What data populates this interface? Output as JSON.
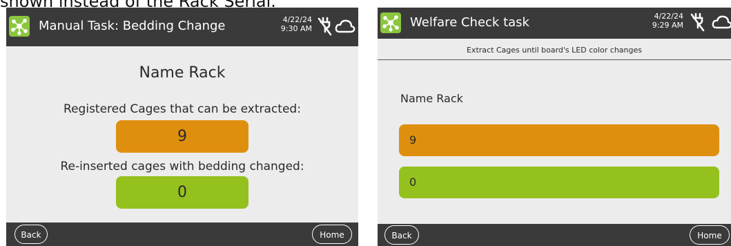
{
  "caption": "shown instead of the Rack Serial.",
  "left": {
    "title": "Manual Task: Bedding Change",
    "date": "4/22/24",
    "time": "9:30 AM",
    "rack_name": "Name Rack",
    "registered_label": "Registered Cages that can be extracted:",
    "registered_value": "9",
    "reinserted_label": "Re-inserted cages with bedding changed:",
    "reinserted_value": "0",
    "back_label": "Back",
    "home_label": "Home"
  },
  "right": {
    "title": "Welfare Check task",
    "date": "4/22/24",
    "time": "9:29 AM",
    "instruction": "Extract Cages until board's LED color changes",
    "rack_name": "Name Rack",
    "orange_value": "9",
    "green_value": "0",
    "back_label": "Back",
    "home_label": "Home"
  },
  "colors": {
    "bar": "#3a3a3a",
    "screen_bg": "#ececec",
    "orange": "#df8f0e",
    "green": "#95c11f",
    "app_icon": "#8cc63f"
  },
  "icons": {
    "app": "network-nodes-icon",
    "status_1": "unplugged-icon",
    "status_2": "cloud-icon"
  }
}
